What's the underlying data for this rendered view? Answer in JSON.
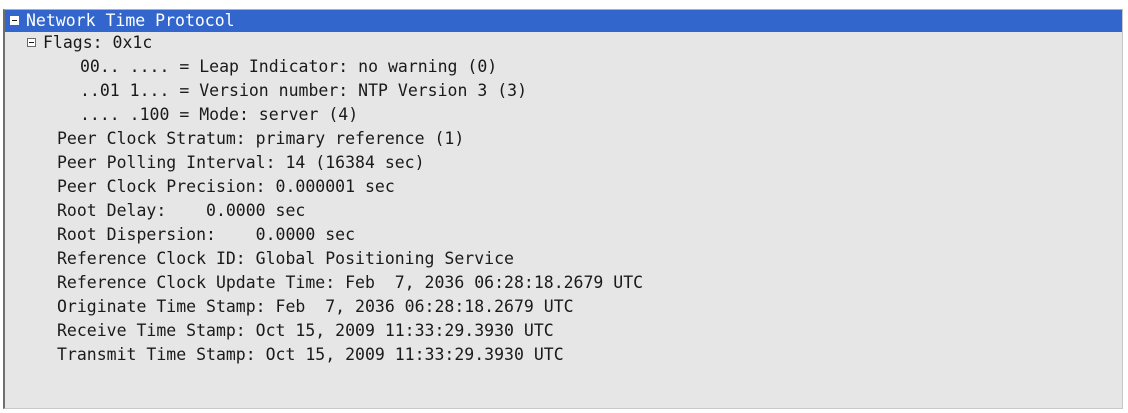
{
  "tree": {
    "root": {
      "label": "Network Time Protocol",
      "icon": "collapse-minus-icon"
    },
    "flags": {
      "label": "Flags: 0x1c",
      "icon": "collapse-minus-icon",
      "children": [
        "00.. .... = Leap Indicator: no warning (0)",
        "..01 1... = Version number: NTP Version 3 (3)",
        ".... .100 = Mode: server (4)"
      ]
    },
    "fields": [
      "Peer Clock Stratum: primary reference (1)",
      "Peer Polling Interval: 14 (16384 sec)",
      "Peer Clock Precision: 0.000001 sec",
      "Root Delay:    0.0000 sec",
      "Root Dispersion:    0.0000 sec",
      "Reference Clock ID: Global Positioning Service",
      "Reference Clock Update Time: Feb  7, 2036 06:28:18.2679 UTC",
      "Originate Time Stamp: Feb  7, 2036 06:28:18.2679 UTC",
      "Receive Time Stamp: Oct 15, 2009 11:33:29.3930 UTC",
      "Transmit Time Stamp: Oct 15, 2009 11:33:29.3930 UTC"
    ]
  },
  "colors": {
    "selection": "#3366cc",
    "pane_background": "#e6e6e6"
  }
}
